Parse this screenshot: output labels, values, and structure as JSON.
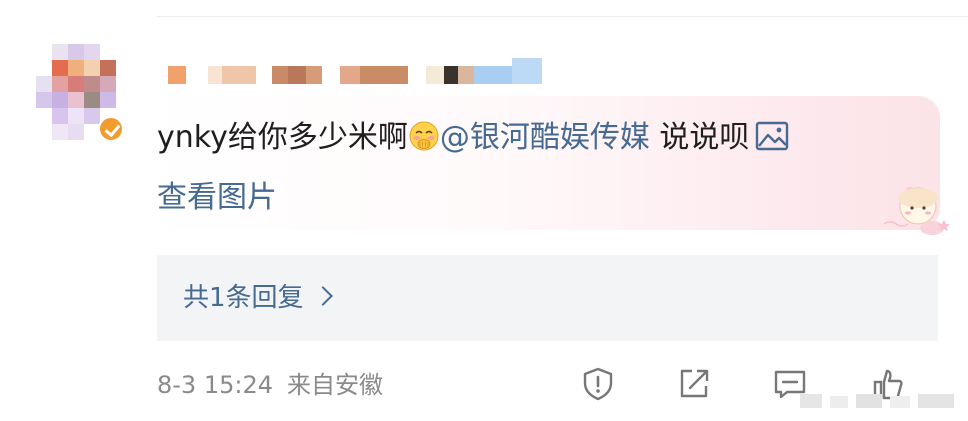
{
  "comment": {
    "text_prefix": "ynky给你多少米啊",
    "emoji": "shy-covering-mouth-emoji",
    "mention": "@银河酷娱传媒",
    "text_suffix": " 说说呗",
    "view_image_label": "查看图片"
  },
  "replies": {
    "label": "共1条回复"
  },
  "meta": {
    "date": "8-3 15:24",
    "location": "来自安徽"
  },
  "icons": {
    "report": "report-shield-icon",
    "share": "share-icon",
    "comment": "comment-icon",
    "like": "like-icon",
    "image": "image-icon"
  },
  "colors": {
    "link": "#466a92",
    "meta_text": "#8a8a8a",
    "reply_box_bg": "#f3f4f6",
    "verify_badge": "#f29b2e"
  }
}
